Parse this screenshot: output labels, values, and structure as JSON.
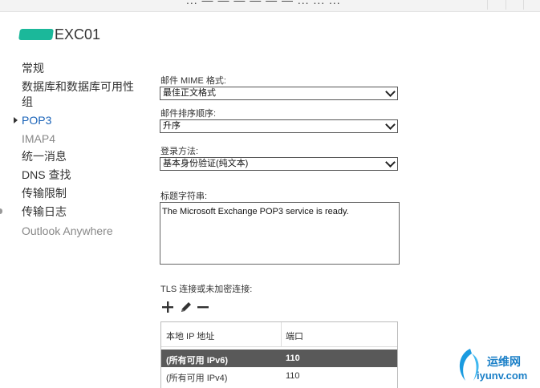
{
  "window": {
    "title_fragment": "... — — — — — — ... ... ..."
  },
  "server": {
    "name_suffix": "EXC01"
  },
  "nav": {
    "items": [
      {
        "label": "常规",
        "state": "normal"
      },
      {
        "label": "数据库和数据库可用性",
        "state": "normal"
      },
      {
        "label": "组",
        "state": "normal"
      },
      {
        "label": "POP3",
        "state": "active"
      },
      {
        "label": "IMAP4",
        "state": "muted"
      },
      {
        "label": "统一消息",
        "state": "normal"
      },
      {
        "label": "DNS 查找",
        "state": "normal"
      },
      {
        "label": "传输限制",
        "state": "normal"
      },
      {
        "label": "传输日志",
        "state": "normal"
      },
      {
        "label": "Outlook Anywhere",
        "state": "muted"
      }
    ]
  },
  "form": {
    "mime_label": "邮件 MIME 格式:",
    "mime_value": "最佳正文格式",
    "sort_label": "邮件排序顺序:",
    "sort_value": "升序",
    "login_label": "登录方法:",
    "login_value": "基本身份验证(纯文本)",
    "banner_label": "标题字符串:",
    "banner_value": "The Microsoft Exchange POP3 service is ready.",
    "tls_label": "TLS 连接或未加密连接:"
  },
  "toolbar": {
    "add": "add-icon",
    "edit": "pencil-icon",
    "remove": "minus-icon"
  },
  "table": {
    "headers": [
      "本地 IP 地址",
      "端口"
    ],
    "rows": [
      {
        "ip": "(所有可用 IPv6)",
        "port": "110",
        "selected": true
      },
      {
        "ip": "(所有可用 IPv4)",
        "port": "110",
        "selected": false
      }
    ]
  },
  "watermark": {
    "line1": "运维网",
    "line2": "iyunv.com"
  },
  "colors": {
    "accent": "#1a63b8",
    "selected_row": "#595959",
    "redaction": "#1bb89a"
  }
}
